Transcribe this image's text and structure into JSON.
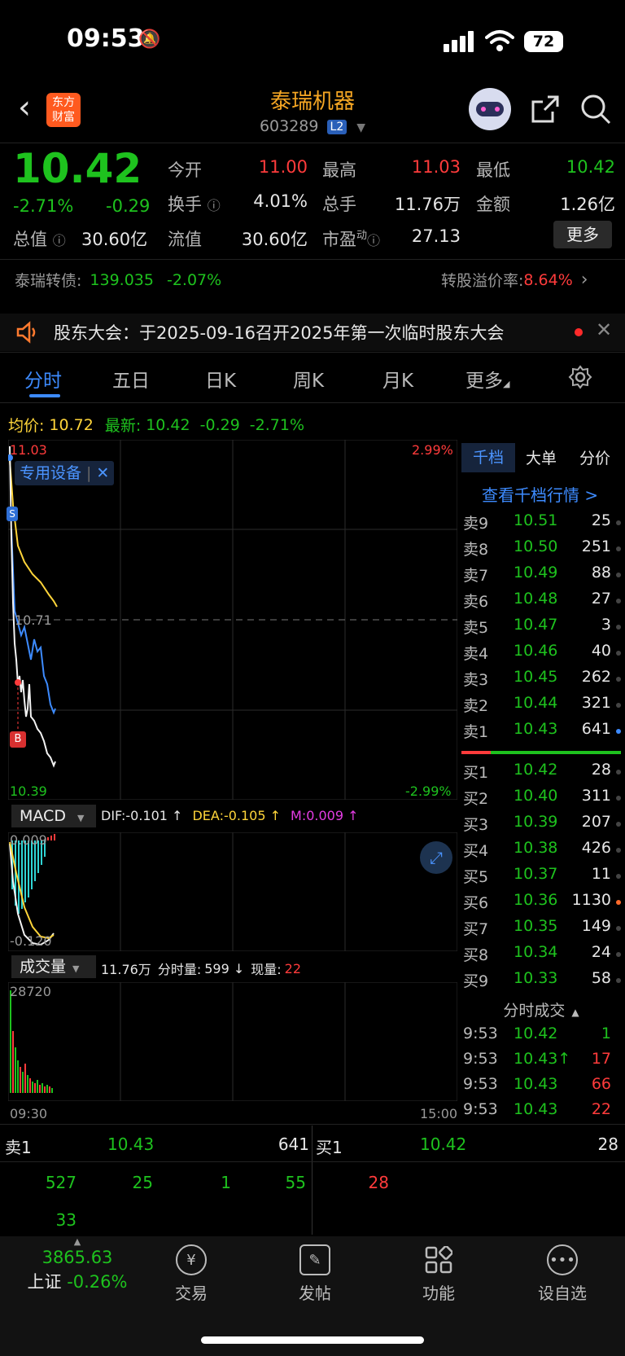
{
  "status_bar": {
    "time": "09:53",
    "battery": "72"
  },
  "nav": {
    "title": "泰瑞机器",
    "code": "603289",
    "level_badge": "L2",
    "logo_line1": "东方",
    "logo_line2": "财富"
  },
  "quote": {
    "price": "10.42",
    "change_pct": "-2.71%",
    "change": "-0.29",
    "open_label": "今开",
    "open": "11.00",
    "high_label": "最高",
    "high": "11.03",
    "low_label": "最低",
    "low": "10.42",
    "turnover_label": "换手",
    "turnover": "4.01%",
    "volume_label": "总手",
    "volume": "11.76万",
    "amount_label": "金额",
    "amount": "1.26亿",
    "mktcap_label": "总值",
    "mktcap": "30.60亿",
    "float_label": "流值",
    "float": "30.60亿",
    "pe_label": "市盈",
    "pe_sup": "动",
    "pe": "27.13",
    "more_button": "更多"
  },
  "convertible": {
    "label": "泰瑞转债:",
    "price": "139.035",
    "change": "-2.07%",
    "premium_label": "转股溢价率:",
    "premium": "8.64%"
  },
  "notice": {
    "text": "股东大会：于2025-09-16召开2025年第一次临时股东大会"
  },
  "tabs": [
    "分时",
    "五日",
    "日K",
    "周K",
    "月K",
    "更多"
  ],
  "intraday": {
    "avg_label": "均价:",
    "avg": "10.72",
    "latest_label": "最新:",
    "latest": "10.42",
    "latest_change": "-0.29",
    "latest_pct": "-2.71%",
    "top_price": "11.03",
    "top_pct": "2.99%",
    "bottom_price": "10.39",
    "bottom_pct": "-2.99%",
    "mid_price": "10.71",
    "sector_tag": "专用设备",
    "marker_s": "S",
    "marker_b": "B"
  },
  "macd": {
    "label": "MACD",
    "dif": "DIF:-0.101 ↑",
    "dea": "DEA:-0.105 ↑",
    "m": "M:0.009 ↑",
    "top": "0.009",
    "bottom": "-0.120"
  },
  "volume_panel": {
    "label": "成交量",
    "total": "11.76万",
    "minute_label": "分时量:",
    "minute": "599 ↓",
    "now_label": "现量:",
    "now": "22",
    "max": "28720",
    "time_start": "09:30",
    "time_end": "15:00"
  },
  "orderbook": {
    "tabs": [
      "千档",
      "大单",
      "分价"
    ],
    "link": "查看千档行情 >",
    "asks": [
      {
        "lvl": "卖9",
        "px": "10.51",
        "vol": "25"
      },
      {
        "lvl": "卖8",
        "px": "10.50",
        "vol": "251"
      },
      {
        "lvl": "卖7",
        "px": "10.49",
        "vol": "88"
      },
      {
        "lvl": "卖6",
        "px": "10.48",
        "vol": "27"
      },
      {
        "lvl": "卖5",
        "px": "10.47",
        "vol": "3"
      },
      {
        "lvl": "卖4",
        "px": "10.46",
        "vol": "40"
      },
      {
        "lvl": "卖3",
        "px": "10.45",
        "vol": "262"
      },
      {
        "lvl": "卖2",
        "px": "10.44",
        "vol": "321"
      },
      {
        "lvl": "卖1",
        "px": "10.43",
        "vol": "641"
      }
    ],
    "bids": [
      {
        "lvl": "买1",
        "px": "10.42",
        "vol": "28"
      },
      {
        "lvl": "买2",
        "px": "10.40",
        "vol": "311"
      },
      {
        "lvl": "买3",
        "px": "10.39",
        "vol": "207"
      },
      {
        "lvl": "买4",
        "px": "10.38",
        "vol": "426"
      },
      {
        "lvl": "买5",
        "px": "10.37",
        "vol": "11"
      },
      {
        "lvl": "买6",
        "px": "10.36",
        "vol": "1130"
      },
      {
        "lvl": "买7",
        "px": "10.35",
        "vol": "149"
      },
      {
        "lvl": "买8",
        "px": "10.34",
        "vol": "24"
      },
      {
        "lvl": "买9",
        "px": "10.33",
        "vol": "58"
      }
    ],
    "ticks_label": "分时成交",
    "ticks": [
      {
        "t": "9:53",
        "px": "10.42",
        "vol": "1"
      },
      {
        "t": "9:53",
        "px": "10.43↑",
        "vol": "17"
      },
      {
        "t": "9:53",
        "px": "10.43",
        "vol": "66"
      },
      {
        "t": "9:53",
        "px": "10.43",
        "vol": "22"
      }
    ]
  },
  "queue": {
    "sell_label": "卖1",
    "sell_px": "10.43",
    "sell_vol": "641",
    "buy_label": "买1",
    "buy_px": "10.42",
    "buy_vol": "28",
    "sell_orders": [
      "527",
      "25",
      "1",
      "55",
      "33"
    ],
    "buy_orders": [
      "28"
    ]
  },
  "bottom_bar": {
    "index_value": "3865.63",
    "index_name": "上证",
    "index_change": "-0.26%",
    "items": [
      "交易",
      "发帖",
      "功能",
      "设自选"
    ]
  }
}
